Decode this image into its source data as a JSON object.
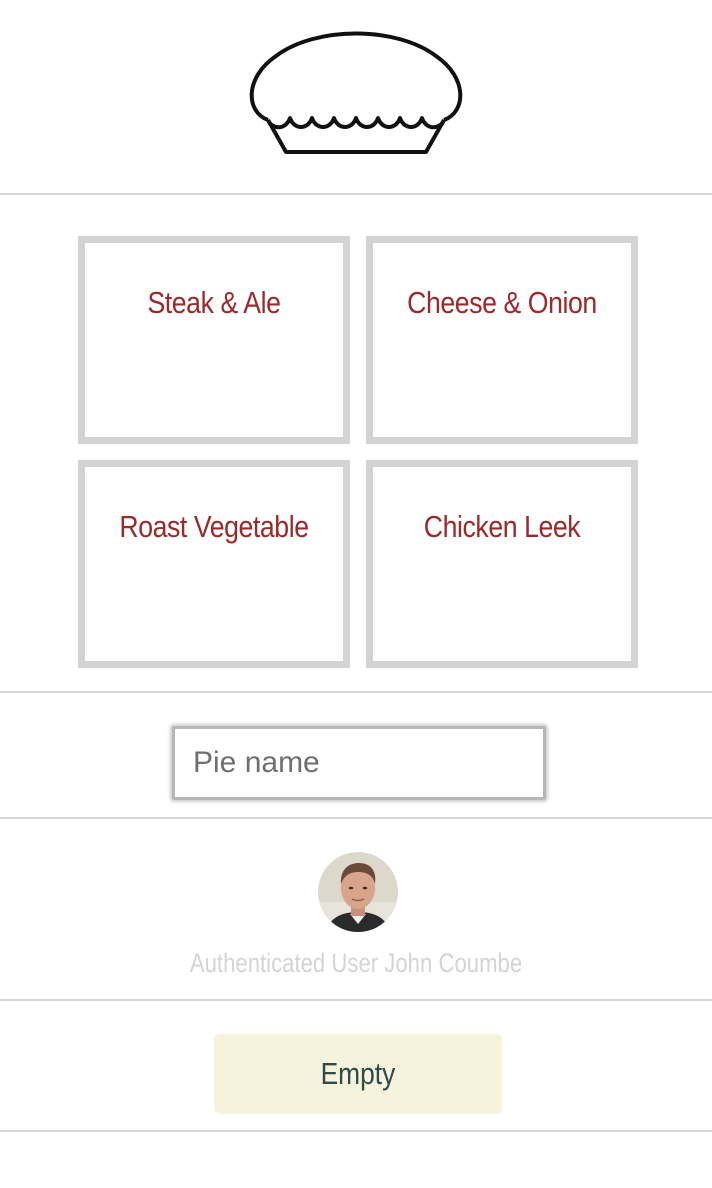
{
  "logo": {
    "icon": "pie-icon"
  },
  "pies": [
    {
      "name": "Steak & Ale"
    },
    {
      "name": "Cheese & Onion"
    },
    {
      "name": "Roast Vegetable"
    },
    {
      "name": "Chicken Leek"
    }
  ],
  "form": {
    "placeholder": "Pie name",
    "value": ""
  },
  "user": {
    "label": "Authenticated User John Coumbe",
    "avatar_icon": "user-avatar"
  },
  "actions": {
    "empty_label": "Empty"
  },
  "colors": {
    "pie_title": "#9b2a2a",
    "card_border": "#d3d3d3",
    "button_bg": "#f5f3dc",
    "button_text": "#2f4a4a",
    "muted_text": "#d4d4d4"
  }
}
